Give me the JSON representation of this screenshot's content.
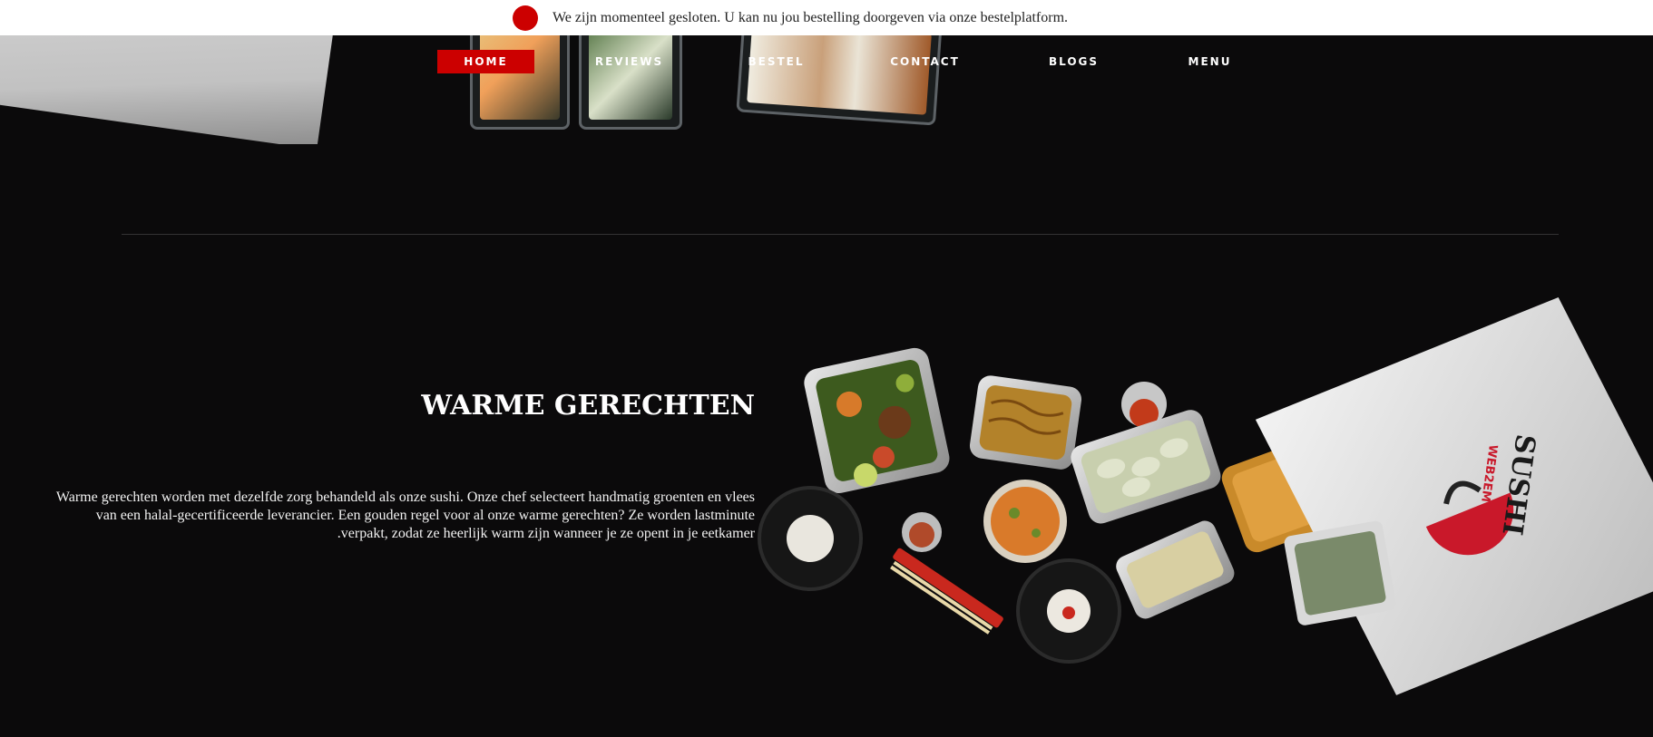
{
  "notice": {
    "message": "We zijn momenteel gesloten. U kan nu jou bestelling doorgeven via onze bestelplatform.",
    "status_color": "#cc0000"
  },
  "nav": {
    "items": [
      {
        "label": "HOME",
        "active": true
      },
      {
        "label": "REVIEWS",
        "active": false
      },
      {
        "label": "BESTEL",
        "active": false
      },
      {
        "label": "CONTACT",
        "active": false
      },
      {
        "label": "BLOGS",
        "active": false
      },
      {
        "label": "MENU",
        "active": false
      }
    ]
  },
  "section": {
    "title": "WARME GERECHTEN",
    "body": "Warme gerechten worden met dezelfde zorg behandeld als onze sushi. Onze chef selecteert handmatig groenten en vlees van een halal-gecertificeerde leverancier. Een gouden regel voor al onze warme gerechten? Ze worden lastminute .verpakt, zodat ze heerlijk warm zijn wanneer je ze opent in je eetkamer"
  },
  "bag": {
    "brand": "SUSHI",
    "tagline": "WEB2EM"
  },
  "colors": {
    "accent": "#cc0000",
    "background": "#0b0a0b"
  }
}
